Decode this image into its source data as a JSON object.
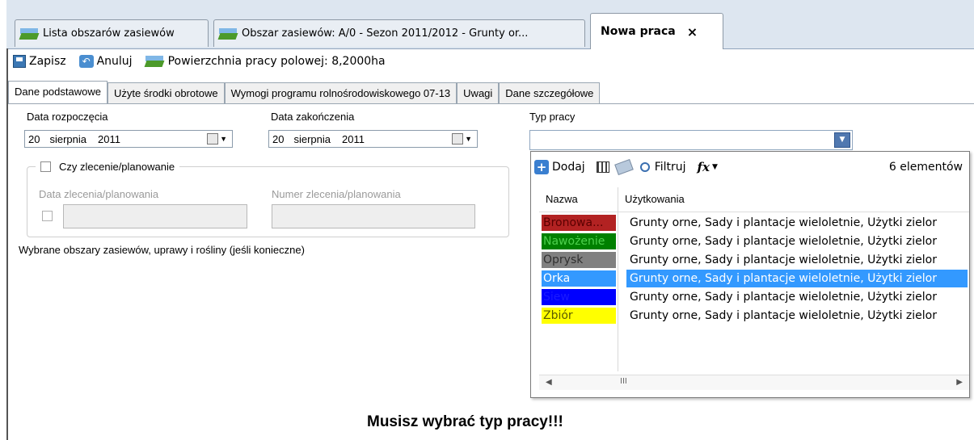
{
  "window_tabs": [
    {
      "label": "Lista obszarów zasiewów"
    },
    {
      "label": "Obszar zasiewów: A/0 - Sezon 2011/2012 - Grunty or..."
    },
    {
      "label": "Nowa praca",
      "close": "×"
    }
  ],
  "toolbar": {
    "save_label": "Zapisz",
    "cancel_label": "Anuluj",
    "area_label": "Powierzchnia pracy polowej: 8,2000ha"
  },
  "inner_tabs": [
    {
      "label": "Dane podstawowe"
    },
    {
      "label": "Użyte środki obrotowe"
    },
    {
      "label": "Wymogi programu rolnośrodowiskowego 07-13"
    },
    {
      "label": "Uwagi"
    },
    {
      "label": "Dane szczegółowe"
    }
  ],
  "form": {
    "start_date_label": "Data rozpoczęcia",
    "start_date": {
      "day": "20",
      "month": "sierpnia",
      "year": "2011"
    },
    "end_date_label": "Data zakończenia",
    "end_date": {
      "day": "20",
      "month": "sierpnia",
      "year": "2011"
    },
    "work_type_label": "Typ pracy",
    "order_checkbox_label": "Czy zlecenie/planowanie",
    "order_date_label": "Data zlecenia/planowania",
    "order_number_label": "Numer zlecenia/planowania",
    "selected_areas_label": "Wybrane obszary zasiewów, uprawy i rośliny (jeśli konieczne)"
  },
  "popup": {
    "add_label": "Dodaj",
    "filter_label": "Filtruj",
    "fx_label": "fx",
    "count_label": "6 elementów",
    "col_name": "Nazwa",
    "col_use": "Użytkowania",
    "rows": [
      {
        "name": "Bronowa...",
        "use": "Grunty orne, Sady i plantacje wieloletnie, Użytki zielor",
        "color": "#b22222",
        "text_color": "#5a0000"
      },
      {
        "name": "Nawożenie",
        "use": "Grunty orne, Sady i plantacje wieloletnie, Użytki zielor",
        "color": "#008000",
        "text_color": "#4fd14f"
      },
      {
        "name": "Oprysk",
        "use": "Grunty orne, Sady i plantacje wieloletnie, Użytki zielor",
        "color": "#808080",
        "text_color": "#303030"
      },
      {
        "name": "Orka",
        "use": "Grunty orne, Sady i plantacje wieloletnie, Użytki zielor",
        "color": "#3399ff",
        "text_color": "#ffffff"
      },
      {
        "name": "Siew",
        "use": "Grunty orne, Sady i plantacje wieloletnie, Użytki zielor",
        "color": "#0000ff",
        "text_color": "#1a1aff"
      },
      {
        "name": "Zbiór",
        "use": "Grunty orne, Sady i plantacje wieloletnie, Użytki zielor",
        "color": "#ffff00",
        "text_color": "#5a5a00"
      }
    ],
    "selected_row": 3,
    "scroll_thumb": "III"
  },
  "message": "Musisz wybrać typ pracy!!!"
}
